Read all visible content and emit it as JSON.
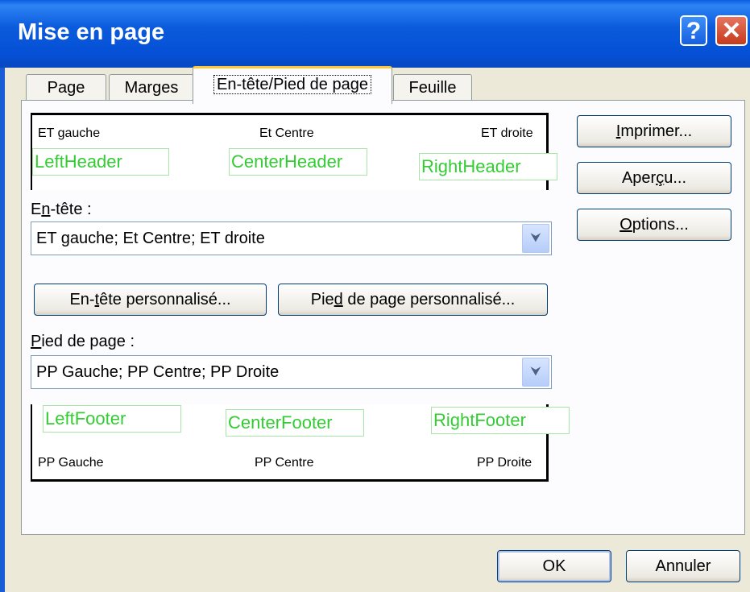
{
  "window": {
    "title": "Mise en page",
    "help_label": "?",
    "close_label": "✕"
  },
  "tabs": [
    {
      "label": "Page"
    },
    {
      "label": "Marges"
    },
    {
      "label": "En-tête/Pied de page"
    },
    {
      "label": "Feuille"
    }
  ],
  "header_preview": {
    "left": "ET gauche",
    "center": "Et Centre",
    "right": "ET droite",
    "left_field": "LeftHeader",
    "center_field": "CenterHeader",
    "right_field": "RightHeader"
  },
  "header": {
    "label_pre": "E",
    "label_u": "n",
    "label_post": "-tête :",
    "value": "ET gauche; Et Centre; ET droite"
  },
  "custom_buttons": {
    "header_pre": "En-",
    "header_u": "t",
    "header_post": "ête personnalisé...",
    "footer_pre": "Pie",
    "footer_u": "d",
    "footer_post": " de page personnalisé..."
  },
  "footer": {
    "label_pre": "",
    "label_u": "P",
    "label_post": "ied de page :",
    "value": "PP Gauche; PP Centre; PP Droite"
  },
  "footer_preview": {
    "left": "PP Gauche",
    "center": "PP Centre",
    "right": "PP Droite",
    "left_field": "LeftFooter",
    "center_field": "CenterFooter",
    "right_field": "RightFooter"
  },
  "side_buttons": {
    "print_u": "I",
    "print_post": "mprimer...",
    "preview_pre": "Aper",
    "preview_u": "ç",
    "preview_post": "u...",
    "options_u": "O",
    "options_post": "ptions..."
  },
  "dialog_buttons": {
    "ok": "OK",
    "cancel": "Annuler"
  },
  "icons": {
    "combo_arrow": "chevron-down-icon"
  }
}
